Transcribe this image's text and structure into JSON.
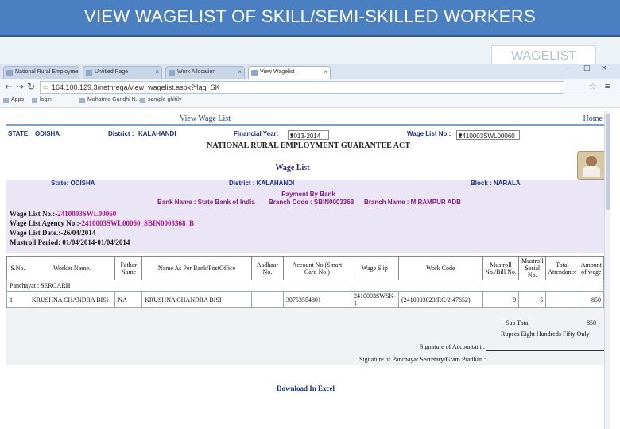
{
  "slide": {
    "title": "VIEW WAGELIST OF SKILL/SEMI-SKILLED WORKERS",
    "badge": "WAGELIST"
  },
  "browser": {
    "tabs": [
      {
        "label": "National Rural Employme"
      },
      {
        "label": "Untitled Page"
      },
      {
        "label": "Work Allocation"
      },
      {
        "label": "View Wagelist"
      }
    ],
    "url": "164.100.129.3/netnrega/view_wagelist.aspx?flag_SK",
    "bookmarks": [
      {
        "label": "Apps"
      },
      {
        "label": "login"
      },
      {
        "label": "Mahatma Gandhi N..."
      },
      {
        "label": "sample ghitily"
      }
    ],
    "window_controls": [
      "–",
      "□",
      "×"
    ]
  },
  "page": {
    "title": "View Wage List",
    "home": "Home",
    "filters": {
      "state_label": "STATE:",
      "state_value": "ODISHA",
      "district_label": "District :",
      "district_value": "KALAHANDI",
      "fy_label": "Financial Year:",
      "fy_value": "2013-2014",
      "wl_label": "Wage List No.:",
      "wl_value": "2410003SWL00060"
    },
    "act_title": "NATIONAL RURAL EMPLOYMENT GUARANTEE ACT",
    "wage_list_label": "Wage List",
    "state_line": {
      "state": "State: ODISHA",
      "district": "District : KALAHANDI",
      "block": "Block : NARALA"
    },
    "payment": {
      "heading": "Payment By Bank",
      "bank_name": "Bank Name : State Bank of India",
      "branch_code": "Branch Code : SBIN0003368",
      "branch_name": "Branch Name : M RAMPUR ADB"
    },
    "info": {
      "wl_no_label": "Wage List No.:-",
      "wl_no_value": "2410003SWL00060",
      "agency_label": "Wage List Agency No.:-",
      "agency_value": "2410003SWL00060_SBIN0003368_B",
      "date_label": "Wage List Date.:-",
      "date_value": "26/04/2014",
      "mustroll": "Mustroll Period: 01/04/2014-01/04/2014"
    },
    "table": {
      "headers": [
        "S.No.",
        "Worker Name.",
        "Father Name",
        "Name As Per Bank/PostOffice",
        "Aadhaar No.",
        "Account No.(Smart Card No.)",
        "Wage Slip",
        "Work Code",
        "Mustroll No./Bill No.",
        "Mustroll Serial No.",
        "Total Attendance",
        "Amount of wage"
      ],
      "panchayat": "Panchayat : SERGARH",
      "row": [
        "1",
        "KRUSHNA CHANDRA BISI",
        "NA",
        "KRUSHNA CHANDRA BISI",
        "",
        "30753554801",
        "2410003SWSK-1",
        "(2410003023/RC/2:47652)",
        "9",
        "5",
        "",
        "850"
      ]
    },
    "sub_total_label": "Sub Total",
    "sub_total_value": "850",
    "in_words": "Rupees Eight Hundreds Fifty Only",
    "sign_accountant": "Signature of Accountant :",
    "sign_secretary": "Signature of Panchayat Secretary/Gram Pradhan :",
    "download": "Download In Excel"
  }
}
